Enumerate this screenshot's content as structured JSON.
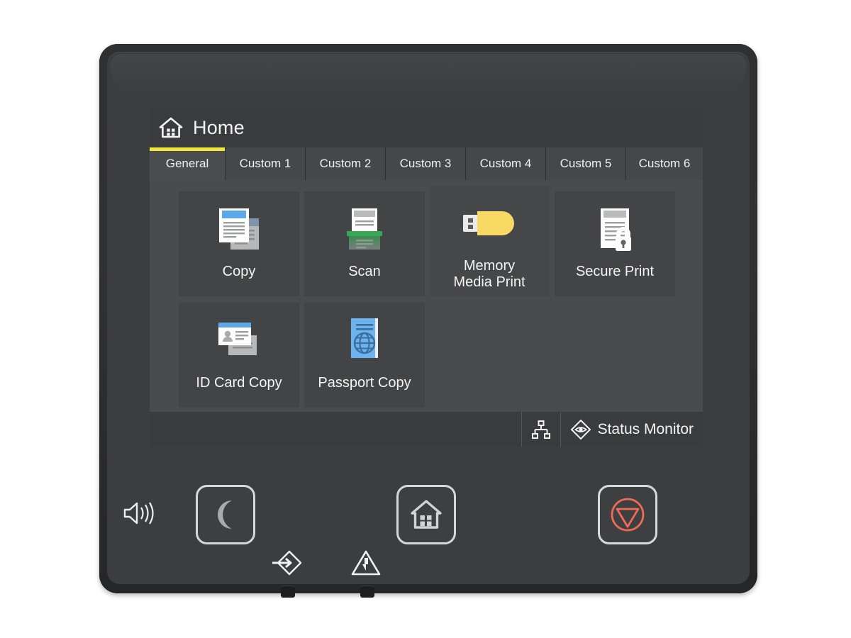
{
  "device": {
    "name": "printer-control-panel",
    "bezel_color": "#2f3032",
    "inner_color": "#3c3d3f"
  },
  "screen": {
    "background": "#3f4042",
    "header": {
      "title": "Home",
      "icon": "home-icon"
    },
    "tabs": [
      {
        "label": "General",
        "active": true,
        "width": 107
      },
      {
        "label": "Custom 1",
        "active": false,
        "width": 113
      },
      {
        "label": "Custom 2",
        "active": false,
        "width": 113
      },
      {
        "label": "Custom 3",
        "active": false,
        "width": 113
      },
      {
        "label": "Custom 4",
        "active": false,
        "width": 113
      },
      {
        "label": "Custom 5",
        "active": false,
        "width": 113
      },
      {
        "label": "Custom 6",
        "active": false,
        "width": 108
      }
    ],
    "active_tab_underline_color": "#f2e63c",
    "tiles": [
      {
        "label": "Copy",
        "icon": "copy-documents-icon",
        "highlight": false
      },
      {
        "label": "Scan",
        "icon": "scanner-icon",
        "highlight": false
      },
      {
        "label": "Memory\nMedia Print",
        "icon": "usb-drive-icon",
        "highlight": true
      },
      {
        "label": "Secure Print",
        "icon": "document-lock-icon",
        "highlight": false
      },
      {
        "label": "ID Card Copy",
        "icon": "id-card-icon",
        "highlight": false
      },
      {
        "label": "Passport Copy",
        "icon": "passport-globe-icon",
        "highlight": false
      }
    ],
    "status_bar": {
      "network_icon": "network-tree-icon",
      "monitor_icon": "status-monitor-eye-icon",
      "monitor_label": "Status Monitor"
    }
  },
  "hardware": {
    "volume_icon": "speaker-volume-icon",
    "buttons": [
      {
        "name": "energy-saver-button",
        "icon": "crescent-moon-icon"
      },
      {
        "name": "home-button",
        "icon": "home-outline-icon"
      },
      {
        "name": "stop-button",
        "icon": "stop-circle-triangle-icon",
        "color": "#f06a56"
      }
    ],
    "indicators": [
      {
        "name": "data-indicator",
        "icon": "data-arrow-diamond-icon"
      },
      {
        "name": "error-indicator",
        "icon": "warning-triangle-icon"
      }
    ]
  },
  "colors": {
    "accent_yellow": "#f2e63c",
    "icon_blue": "#5ba7e8",
    "icon_green": "#3aa757",
    "icon_yellow": "#f7d964",
    "stop_red": "#f06a56",
    "screen_bg": "#3f4042",
    "tile_bg": "#434446"
  }
}
